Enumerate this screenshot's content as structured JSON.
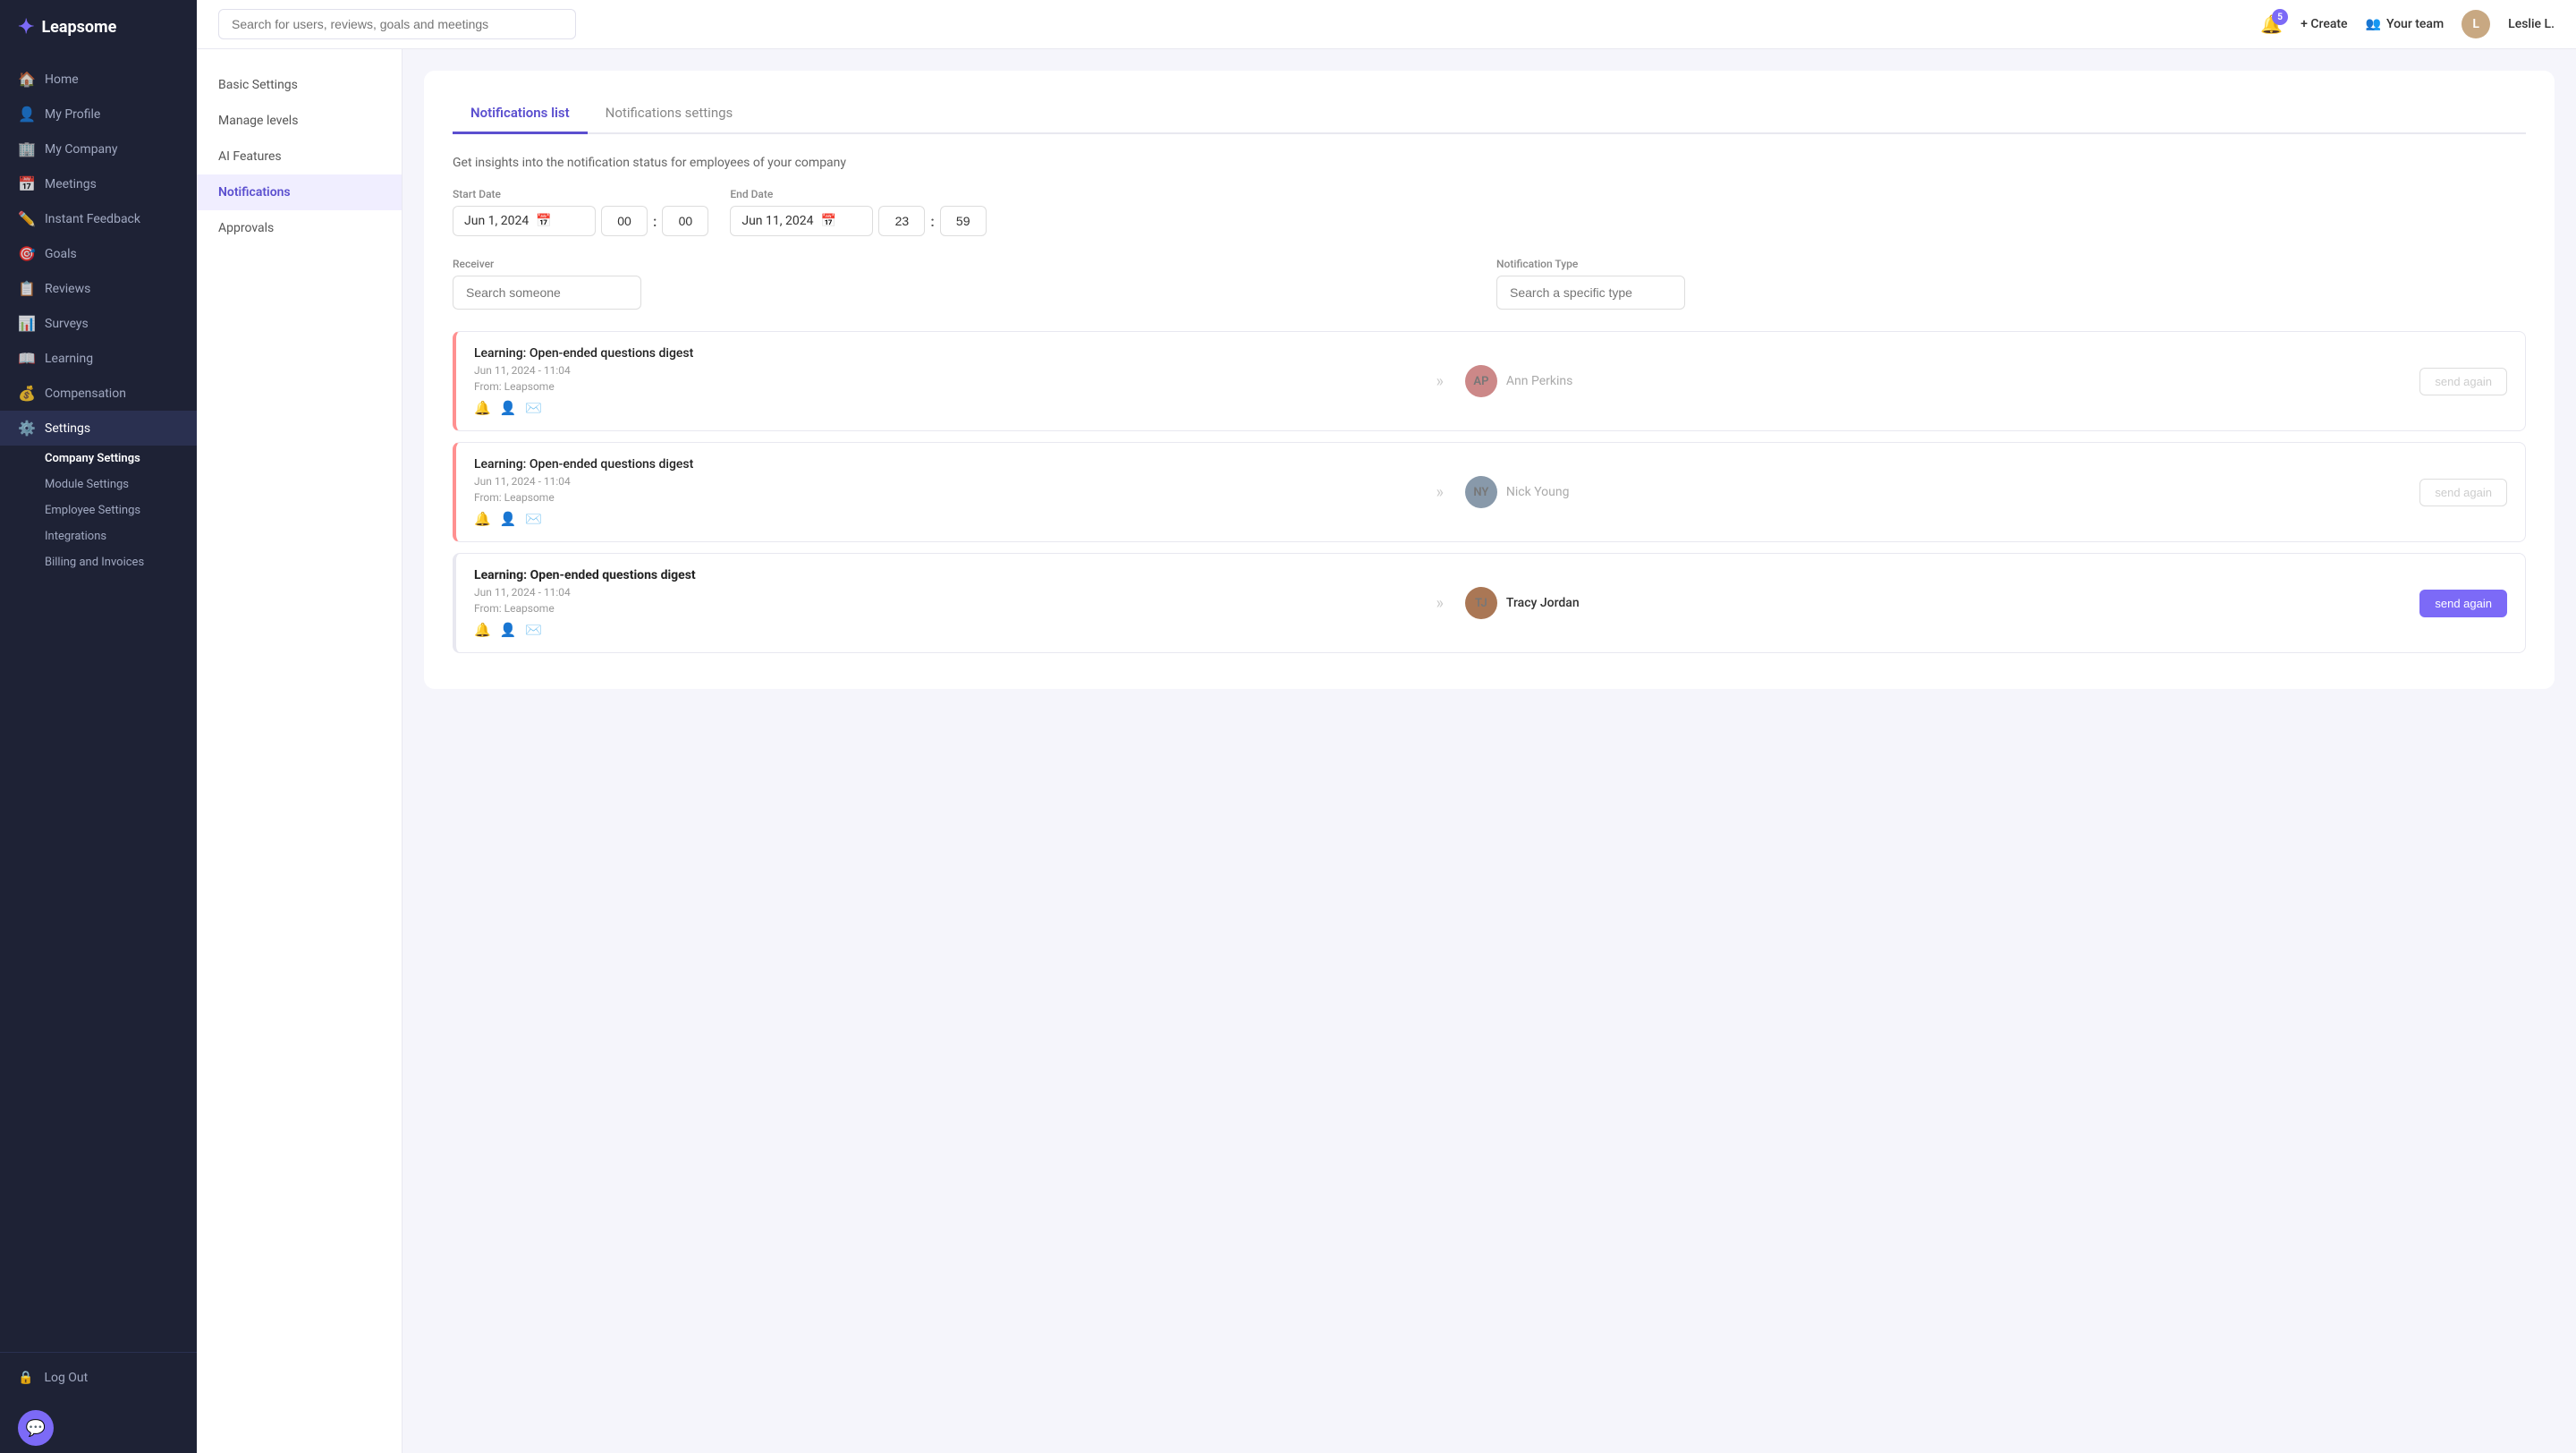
{
  "app": {
    "name": "Leapsome"
  },
  "topbar": {
    "search_placeholder": "Search for users, reviews, goals and meetings",
    "bell_count": "5",
    "create_label": "+ Create",
    "your_team_label": "Your team",
    "user_label": "Leslie L."
  },
  "sidebar": {
    "nav_items": [
      {
        "id": "home",
        "label": "Home",
        "icon": "🏠"
      },
      {
        "id": "my-profile",
        "label": "My Profile",
        "icon": "👤"
      },
      {
        "id": "my-company",
        "label": "My Company",
        "icon": "🏢"
      },
      {
        "id": "meetings",
        "label": "Meetings",
        "icon": "📅"
      },
      {
        "id": "instant-feedback",
        "label": "Instant Feedback",
        "icon": "✏️"
      },
      {
        "id": "goals",
        "label": "Goals",
        "icon": "🎯"
      },
      {
        "id": "reviews",
        "label": "Reviews",
        "icon": "📋"
      },
      {
        "id": "surveys",
        "label": "Surveys",
        "icon": "📊"
      },
      {
        "id": "learning",
        "label": "Learning",
        "icon": "📖"
      },
      {
        "id": "compensation",
        "label": "Compensation",
        "icon": "💰"
      },
      {
        "id": "settings",
        "label": "Settings",
        "icon": "⚙️"
      }
    ],
    "sub_items": [
      {
        "id": "company-settings",
        "label": "Company Settings"
      },
      {
        "id": "module-settings",
        "label": "Module Settings"
      },
      {
        "id": "employee-settings",
        "label": "Employee Settings"
      },
      {
        "id": "integrations",
        "label": "Integrations"
      },
      {
        "id": "billing",
        "label": "Billing and Invoices"
      }
    ],
    "logout_label": "Log Out"
  },
  "settings_menu": {
    "items": [
      {
        "id": "basic-settings",
        "label": "Basic Settings"
      },
      {
        "id": "manage-levels",
        "label": "Manage levels"
      },
      {
        "id": "ai-features",
        "label": "AI Features"
      },
      {
        "id": "notifications",
        "label": "Notifications"
      },
      {
        "id": "approvals",
        "label": "Approvals"
      }
    ]
  },
  "main": {
    "tabs": [
      {
        "id": "notifications-list",
        "label": "Notifications list"
      },
      {
        "id": "notifications-settings",
        "label": "Notifications settings"
      }
    ],
    "subtitle": "Get insights into the notification status for employees of your company",
    "filters": {
      "start_date_label": "Start Date",
      "start_date_value": "Jun 1, 2024",
      "start_hour": "00",
      "start_minute": "00",
      "end_date_label": "End Date",
      "end_date_value": "Jun 11, 2024",
      "end_hour": "23",
      "end_minute": "59",
      "receiver_label": "Receiver",
      "receiver_placeholder": "Search someone",
      "type_label": "Notification Type",
      "type_placeholder": "Search a specific type"
    },
    "notifications": [
      {
        "id": "notif-1",
        "title": "Learning: Open-ended questions digest",
        "date": "Jun 11, 2024 - 11:04",
        "from": "From: Leapsome",
        "receiver_name": "Ann Perkins",
        "receiver_initials": "AP",
        "sent": false,
        "send_again_label": "send again",
        "send_again_state": "disabled"
      },
      {
        "id": "notif-2",
        "title": "Learning: Open-ended questions digest",
        "date": "Jun 11, 2024 - 11:04",
        "from": "From: Leapsome",
        "receiver_name": "Nick Young",
        "receiver_initials": "NY",
        "sent": false,
        "send_again_label": "send again",
        "send_again_state": "disabled"
      },
      {
        "id": "notif-3",
        "title": "Learning: Open-ended questions digest",
        "date": "Jun 11, 2024 - 11:04",
        "from": "From: Leapsome",
        "receiver_name": "Tracy Jordan",
        "receiver_initials": "TJ",
        "sent": true,
        "send_again_label": "send again",
        "send_again_state": "active"
      }
    ]
  }
}
